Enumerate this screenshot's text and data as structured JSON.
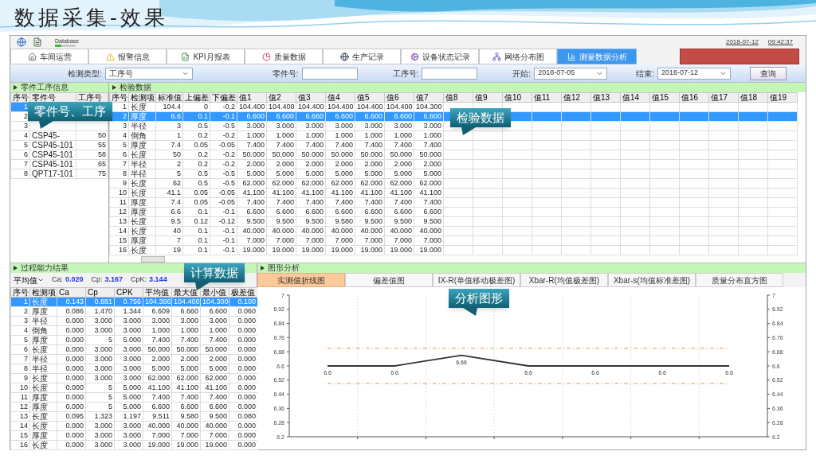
{
  "slide": {
    "title": "数据采集-效果"
  },
  "app": {
    "database_label": "Database",
    "date": "2018-07-12",
    "time": "09:42:37"
  },
  "tabs": [
    {
      "label": "车间运营",
      "selected": false
    },
    {
      "label": "报警信息",
      "selected": false
    },
    {
      "label": "KPI月报表",
      "selected": false
    },
    {
      "label": "质量数据",
      "selected": false
    },
    {
      "label": "生产记录",
      "selected": false
    },
    {
      "label": "设备状态记录",
      "selected": false
    },
    {
      "label": "网络分布图",
      "selected": false
    },
    {
      "label": "测量数据分析",
      "selected": true
    }
  ],
  "filters": {
    "type_label": "检测类型:",
    "type_value": "工序号",
    "part_label": "零件号:",
    "op_label": "工序号:",
    "start_label": "开始:",
    "start_value": "2018-07-05",
    "end_label": "结束:",
    "end_value": "2018-07-12",
    "button": "查询"
  },
  "parts_panel": {
    "title": "零件工序信息",
    "columns": [
      "序号",
      "零件号",
      "工序号"
    ],
    "rows": [
      {
        "cells": [
          "1"
        ],
        "selected": true
      },
      {
        "cells": [
          "2"
        ],
        "selected": false
      },
      {
        "cells": [
          "3"
        ],
        "selected": false
      },
      {
        "cells": [
          "4",
          "CSP45-",
          "50"
        ],
        "selected": false
      },
      {
        "cells": [
          "5",
          "CSP45-101",
          "55"
        ],
        "selected": false
      },
      {
        "cells": [
          "6",
          "CSP45-101",
          "58"
        ],
        "selected": false
      },
      {
        "cells": [
          "7",
          "CSP45-101",
          "65"
        ],
        "selected": false
      },
      {
        "cells": [
          "8",
          "QPT17-101",
          "75"
        ],
        "selected": false
      }
    ]
  },
  "inspection_panel": {
    "title": "检验数据",
    "columns": [
      "序号",
      "检测项",
      "标准值",
      "上偏差",
      "下偏差",
      "值1",
      "值2",
      "值3",
      "值4",
      "值5",
      "值6",
      "值7",
      "值8",
      "值9",
      "值10",
      "值11",
      "值12",
      "值13",
      "值14",
      "值15",
      "值16",
      "值17",
      "值18",
      "值19"
    ],
    "rows": [
      {
        "cells": [
          "1",
          "长度",
          "104.4",
          "0",
          "-0.2",
          "104.400",
          "104.400",
          "104.400",
          "104.400",
          "104.400",
          "104.400",
          "104.300"
        ],
        "selected": false
      },
      {
        "cells": [
          "2",
          "厚度",
          "6.6",
          "0.1",
          "-0.1",
          "6.600",
          "6.600",
          "6.660",
          "6.600",
          "6.600",
          "6.600",
          "6.600"
        ],
        "selected": true
      },
      {
        "cells": [
          "3",
          "半径",
          "3",
          "0.5",
          "-0.5",
          "3.000",
          "3.000",
          "3.000",
          "3.000",
          "3.000",
          "3.000",
          "3.000"
        ],
        "selected": false
      },
      {
        "cells": [
          "4",
          "倒角",
          "1",
          "0.2",
          "-0.2",
          "1.000",
          "1.000",
          "1.000",
          "1.000",
          "1.000",
          "1.000",
          "1.000"
        ],
        "selected": false
      },
      {
        "cells": [
          "5",
          "厚度",
          "7.4",
          "0.05",
          "-0.05",
          "7.400",
          "7.400",
          "7.400",
          "7.400",
          "7.400",
          "7.400",
          "7.400"
        ],
        "selected": false
      },
      {
        "cells": [
          "6",
          "长度",
          "50",
          "0.2",
          "-0.2",
          "50.000",
          "50.000",
          "50.000",
          "50.000",
          "50.000",
          "50.000",
          "50.000"
        ],
        "selected": false
      },
      {
        "cells": [
          "7",
          "半径",
          "2",
          "0.2",
          "-0.2",
          "2.000",
          "2.000",
          "2.000",
          "2.000",
          "2.000",
          "2.000",
          "2.000"
        ],
        "selected": false
      },
      {
        "cells": [
          "8",
          "半径",
          "5",
          "0.5",
          "-0.5",
          "5.000",
          "5.000",
          "5.000",
          "5.000",
          "5.000",
          "5.000",
          "5.000"
        ],
        "selected": false
      },
      {
        "cells": [
          "9",
          "长度",
          "62",
          "0.5",
          "-0.5",
          "62.000",
          "62.000",
          "62.000",
          "62.000",
          "62.000",
          "62.000",
          "62.000"
        ],
        "selected": false
      },
      {
        "cells": [
          "10",
          "长度",
          "41.1",
          "0.05",
          "-0.05",
          "41.100",
          "41.100",
          "41.100",
          "41.100",
          "41.100",
          "41.100",
          "41.100"
        ],
        "selected": false
      },
      {
        "cells": [
          "11",
          "厚度",
          "7.4",
          "0.05",
          "-0.05",
          "7.400",
          "7.400",
          "7.400",
          "7.400",
          "7.400",
          "7.400",
          "7.400"
        ],
        "selected": false
      },
      {
        "cells": [
          "12",
          "厚度",
          "6.6",
          "0.1",
          "-0.1",
          "6.600",
          "6.600",
          "6.600",
          "6.600",
          "6.600",
          "6.600",
          "6.600"
        ],
        "selected": false
      },
      {
        "cells": [
          "13",
          "长度",
          "9.5",
          "0.12",
          "-0.12",
          "9.500",
          "9.500",
          "9.500",
          "9.580",
          "9.500",
          "9.500",
          "9.500"
        ],
        "selected": false
      },
      {
        "cells": [
          "14",
          "长度",
          "40",
          "0.1",
          "-0.1",
          "40.000",
          "40.000",
          "40.000",
          "40.000",
          "40.000",
          "40.000",
          "40.000"
        ],
        "selected": false
      },
      {
        "cells": [
          "15",
          "厚度",
          "7",
          "0.1",
          "-0.1",
          "7.000",
          "7.000",
          "7.000",
          "7.000",
          "7.000",
          "7.000",
          "7.000"
        ],
        "selected": false
      },
      {
        "cells": [
          "16",
          "长度",
          "19",
          "0.1",
          "-0.1",
          "19.000",
          "19.000",
          "19.000",
          "19.000",
          "19.000",
          "19.000",
          "19.000"
        ],
        "selected": false
      }
    ]
  },
  "capability_panel": {
    "title": "过程能力结果",
    "statistic": "平均值",
    "summary": [
      {
        "label": "Ca:",
        "value": "0.020"
      },
      {
        "label": "Cp:",
        "value": "3.167"
      },
      {
        "label": "CpK:",
        "value": "3.144"
      }
    ],
    "columns": [
      "序号",
      "检测项",
      "Ca",
      "Cp",
      "CPK",
      "平均值",
      "最大值",
      "最小值",
      "极差值"
    ],
    "rows": [
      {
        "cells": [
          "1",
          "长度",
          "0.143",
          "0.881",
          "0.756",
          "104.386",
          "104.400",
          "104.300",
          "0.100"
        ],
        "selected": true
      },
      {
        "cells": [
          "2",
          "厚度",
          "0.086",
          "1.470",
          "1.344",
          "6.609",
          "6.660",
          "6.600",
          "0.060"
        ],
        "selected": false
      },
      {
        "cells": [
          "3",
          "半径",
          "0.000",
          "3.000",
          "3.000",
          "3.000",
          "3.000",
          "3.000",
          "0.000"
        ],
        "selected": false
      },
      {
        "cells": [
          "4",
          "倒角",
          "0.000",
          "3.000",
          "3.000",
          "1.000",
          "1.000",
          "1.000",
          "0.000"
        ],
        "selected": false
      },
      {
        "cells": [
          "5",
          "厚度",
          "0.000",
          "5",
          "5.000",
          "7.400",
          "7.400",
          "7.400",
          "0.000"
        ],
        "selected": false
      },
      {
        "cells": [
          "6",
          "长度",
          "0.000",
          "3.000",
          "3.000",
          "50.000",
          "50.000",
          "50.000",
          "0.000"
        ],
        "selected": false
      },
      {
        "cells": [
          "7",
          "半径",
          "0.000",
          "3.000",
          "3.000",
          "2.000",
          "2.000",
          "2.000",
          "0.000"
        ],
        "selected": false
      },
      {
        "cells": [
          "8",
          "半径",
          "0.000",
          "3.000",
          "3.000",
          "5.000",
          "5.000",
          "5.000",
          "0.000"
        ],
        "selected": false
      },
      {
        "cells": [
          "9",
          "长度",
          "0.000",
          "3.000",
          "3.000",
          "62.000",
          "62.000",
          "62.000",
          "0.000"
        ],
        "selected": false
      },
      {
        "cells": [
          "10",
          "长度",
          "0.000",
          "5",
          "5.000",
          "41.100",
          "41.100",
          "41.100",
          "0.000"
        ],
        "selected": false
      },
      {
        "cells": [
          "11",
          "厚度",
          "0.000",
          "5",
          "5.000",
          "7.400",
          "7.400",
          "7.400",
          "0.000"
        ],
        "selected": false
      },
      {
        "cells": [
          "12",
          "厚度",
          "0.000",
          "5",
          "5.000",
          "6.600",
          "6.600",
          "6.600",
          "0.000"
        ],
        "selected": false
      },
      {
        "cells": [
          "13",
          "长度",
          "0.095",
          "1.323",
          "1.197",
          "9.511",
          "9.580",
          "9.500",
          "0.080"
        ],
        "selected": false
      },
      {
        "cells": [
          "14",
          "长度",
          "0.000",
          "3.000",
          "3.000",
          "40.000",
          "40.000",
          "40.000",
          "0.000"
        ],
        "selected": false
      },
      {
        "cells": [
          "15",
          "厚度",
          "0.000",
          "3.000",
          "3.000",
          "7.000",
          "7.000",
          "7.000",
          "0.000"
        ],
        "selected": false
      },
      {
        "cells": [
          "16",
          "长度",
          "0.000",
          "3.000",
          "3.000",
          "19.000",
          "19.000",
          "19.000",
          "0.000"
        ],
        "selected": false
      }
    ]
  },
  "chart_panel": {
    "title": "图形分析",
    "tabs": [
      {
        "label": "实测值折线图",
        "selected": true
      },
      {
        "label": "偏差值图",
        "selected": false
      },
      {
        "label": "IX-R(单值移动极差图)",
        "selected": false
      },
      {
        "label": "Xbar-R(均值极差图)",
        "selected": false
      },
      {
        "label": "Xbar-s(均值标准差图)",
        "selected": false
      },
      {
        "label": "质量分布直方图",
        "selected": false
      }
    ],
    "chart_data": {
      "type": "line",
      "ylim": [
        6.2,
        7
      ],
      "yticks": [
        7,
        6.92,
        6.84,
        6.76,
        6.68,
        6.6,
        6.52,
        6.44,
        6.36,
        6.28,
        6.2
      ],
      "series": [
        {
          "color": "#333333",
          "values": [
            6.6,
            6.6,
            6.66,
            6.6,
            6.6,
            6.6,
            6.6
          ]
        }
      ],
      "data_labels": true,
      "y2lim": [
        6.2,
        7
      ],
      "y2ticks": [
        7,
        6.92,
        6.84,
        6.76,
        6.68,
        6.6,
        6.52,
        6.44,
        6.36,
        6.28,
        6.2
      ],
      "ref_lines": [
        {
          "axis": "y",
          "value": 6.7,
          "color": "#f7b978"
        },
        {
          "axis": "y",
          "value": 6.5,
          "color": "#f7b978"
        }
      ]
    }
  },
  "callouts": [
    {
      "text": "零件号、工序"
    },
    {
      "text": "检验数据"
    },
    {
      "text": "计算数据"
    },
    {
      "text": "分析图形"
    }
  ]
}
